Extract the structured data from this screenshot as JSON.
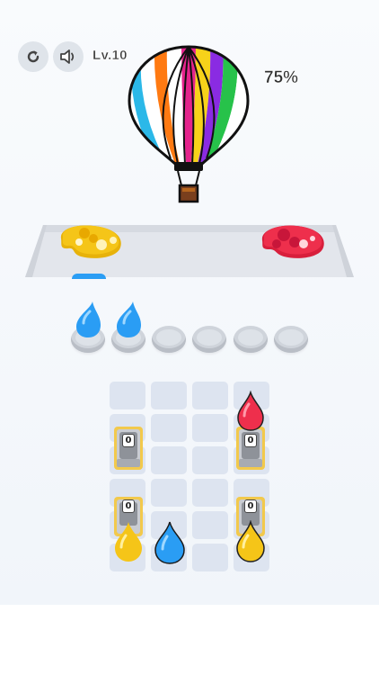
{
  "hud": {
    "restart_icon": "restart-icon",
    "sound_icon": "speaker-icon",
    "level_label": "Lv.10",
    "progress_label": "75%",
    "progress": 0.75
  },
  "picture": {
    "subject_icon": "hot-air-balloon",
    "stripe_colors": [
      "#ffffff",
      "#2bb8e8",
      "#ff7a12",
      "#ffffff",
      "#e4238c",
      "#f7d21a",
      "#8a2be2",
      "#27c24a"
    ]
  },
  "conveyor": {
    "palettes": [
      {
        "color": "#f5c518",
        "side": "left"
      },
      {
        "color": "#ee2f4c",
        "side": "right"
      }
    ]
  },
  "slots": {
    "total": 6,
    "filled": [
      {
        "color": "#2a9df4"
      },
      {
        "color": "#2a9df4"
      }
    ]
  },
  "grid": {
    "machines": [
      {
        "counter": "0",
        "tint": "#f2c94c"
      },
      {
        "counter": "0",
        "tint": "#f2c94c",
        "drop": "#ee2f4c"
      },
      {
        "counter": "0",
        "tint": "#f2c94c",
        "drop": "#f5c518"
      },
      {
        "counter": "0",
        "tint": "#f2c94c",
        "drop": "#f5c518"
      }
    ],
    "free_drop": {
      "color": "#2a9df4"
    }
  }
}
